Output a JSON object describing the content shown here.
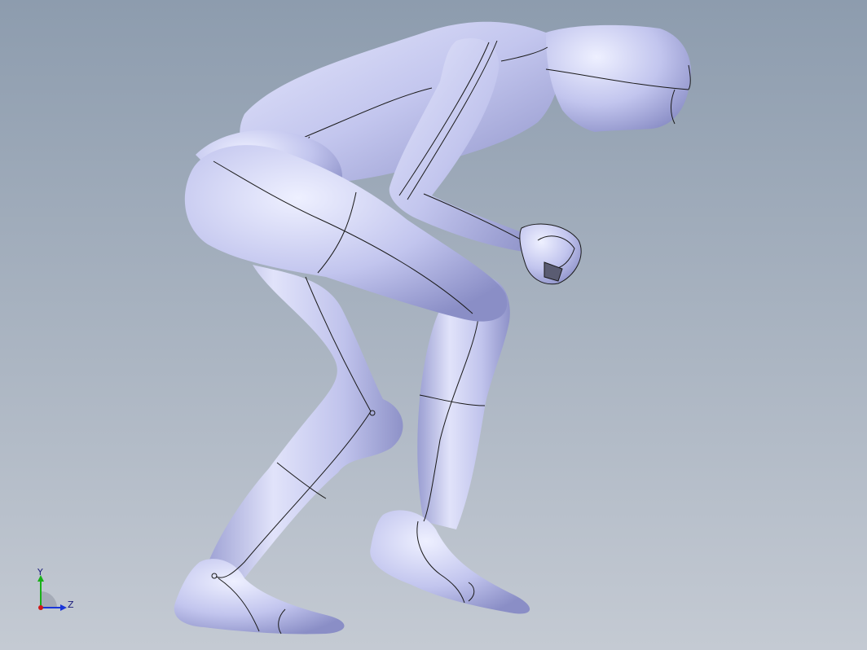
{
  "viewport": {
    "background_top": "#8d9cae",
    "background_bottom": "#c4cad3"
  },
  "model": {
    "surface_color": "#c6c9ee",
    "edge_color": "#1a1a1a"
  },
  "triad": {
    "y_label": "Y",
    "z_label": "Z",
    "y_color": "#18b018",
    "z_color": "#1a36d8",
    "x_color": "#d01818"
  }
}
